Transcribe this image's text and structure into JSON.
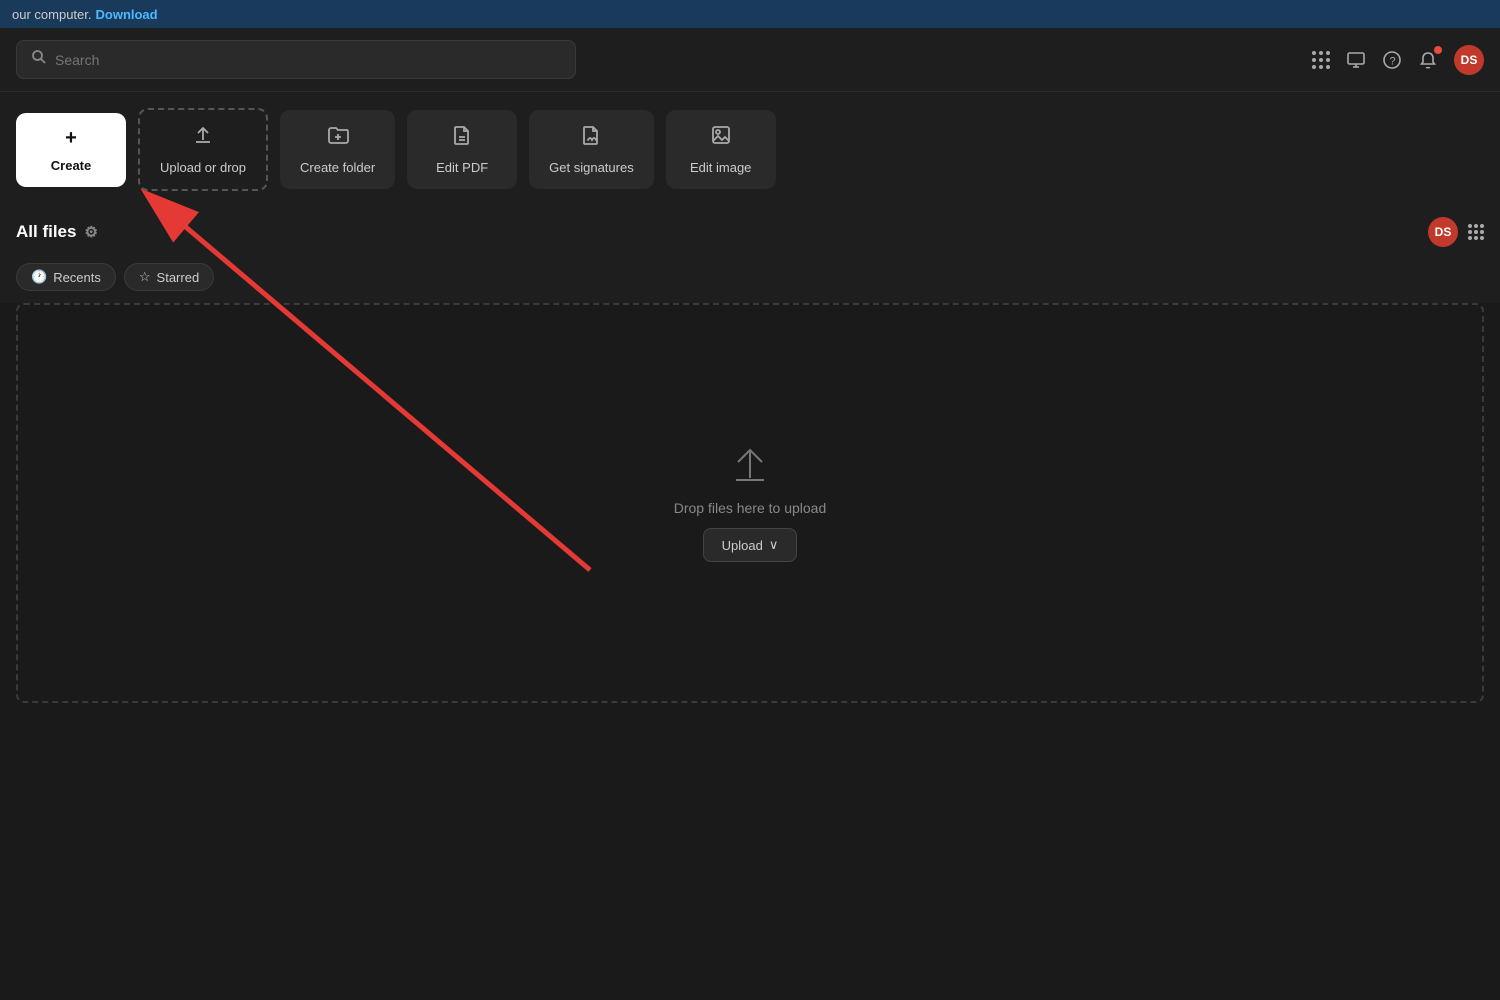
{
  "banner": {
    "text": "our computer.",
    "link_label": "Download"
  },
  "search": {
    "placeholder": "Search"
  },
  "header_icons": {
    "grid_label": "apps-icon",
    "monitor_label": "monitor-icon",
    "question_label": "help-icon",
    "bell_label": "notifications-icon",
    "avatar_label": "DS"
  },
  "actions": [
    {
      "id": "create",
      "label": "Create",
      "icon": "+"
    },
    {
      "id": "upload",
      "label": "Upload or drop",
      "icon": "↑"
    },
    {
      "id": "create-folder",
      "label": "Create folder",
      "icon": "🗀"
    },
    {
      "id": "edit-pdf",
      "label": "Edit PDF",
      "icon": "✎"
    },
    {
      "id": "get-signatures",
      "label": "Get signatures",
      "icon": "🗋"
    },
    {
      "id": "edit-image",
      "label": "Edit image",
      "icon": "🖼"
    }
  ],
  "files_section": {
    "title": "All files",
    "filters": [
      {
        "id": "recents",
        "label": "Recents",
        "icon": "🕐"
      },
      {
        "id": "starred",
        "label": "Starred",
        "icon": "☆"
      }
    ]
  },
  "drop_zone": {
    "drop_text": "Drop files here to upload",
    "upload_button_label": "Upload",
    "upload_chevron": "∨"
  }
}
